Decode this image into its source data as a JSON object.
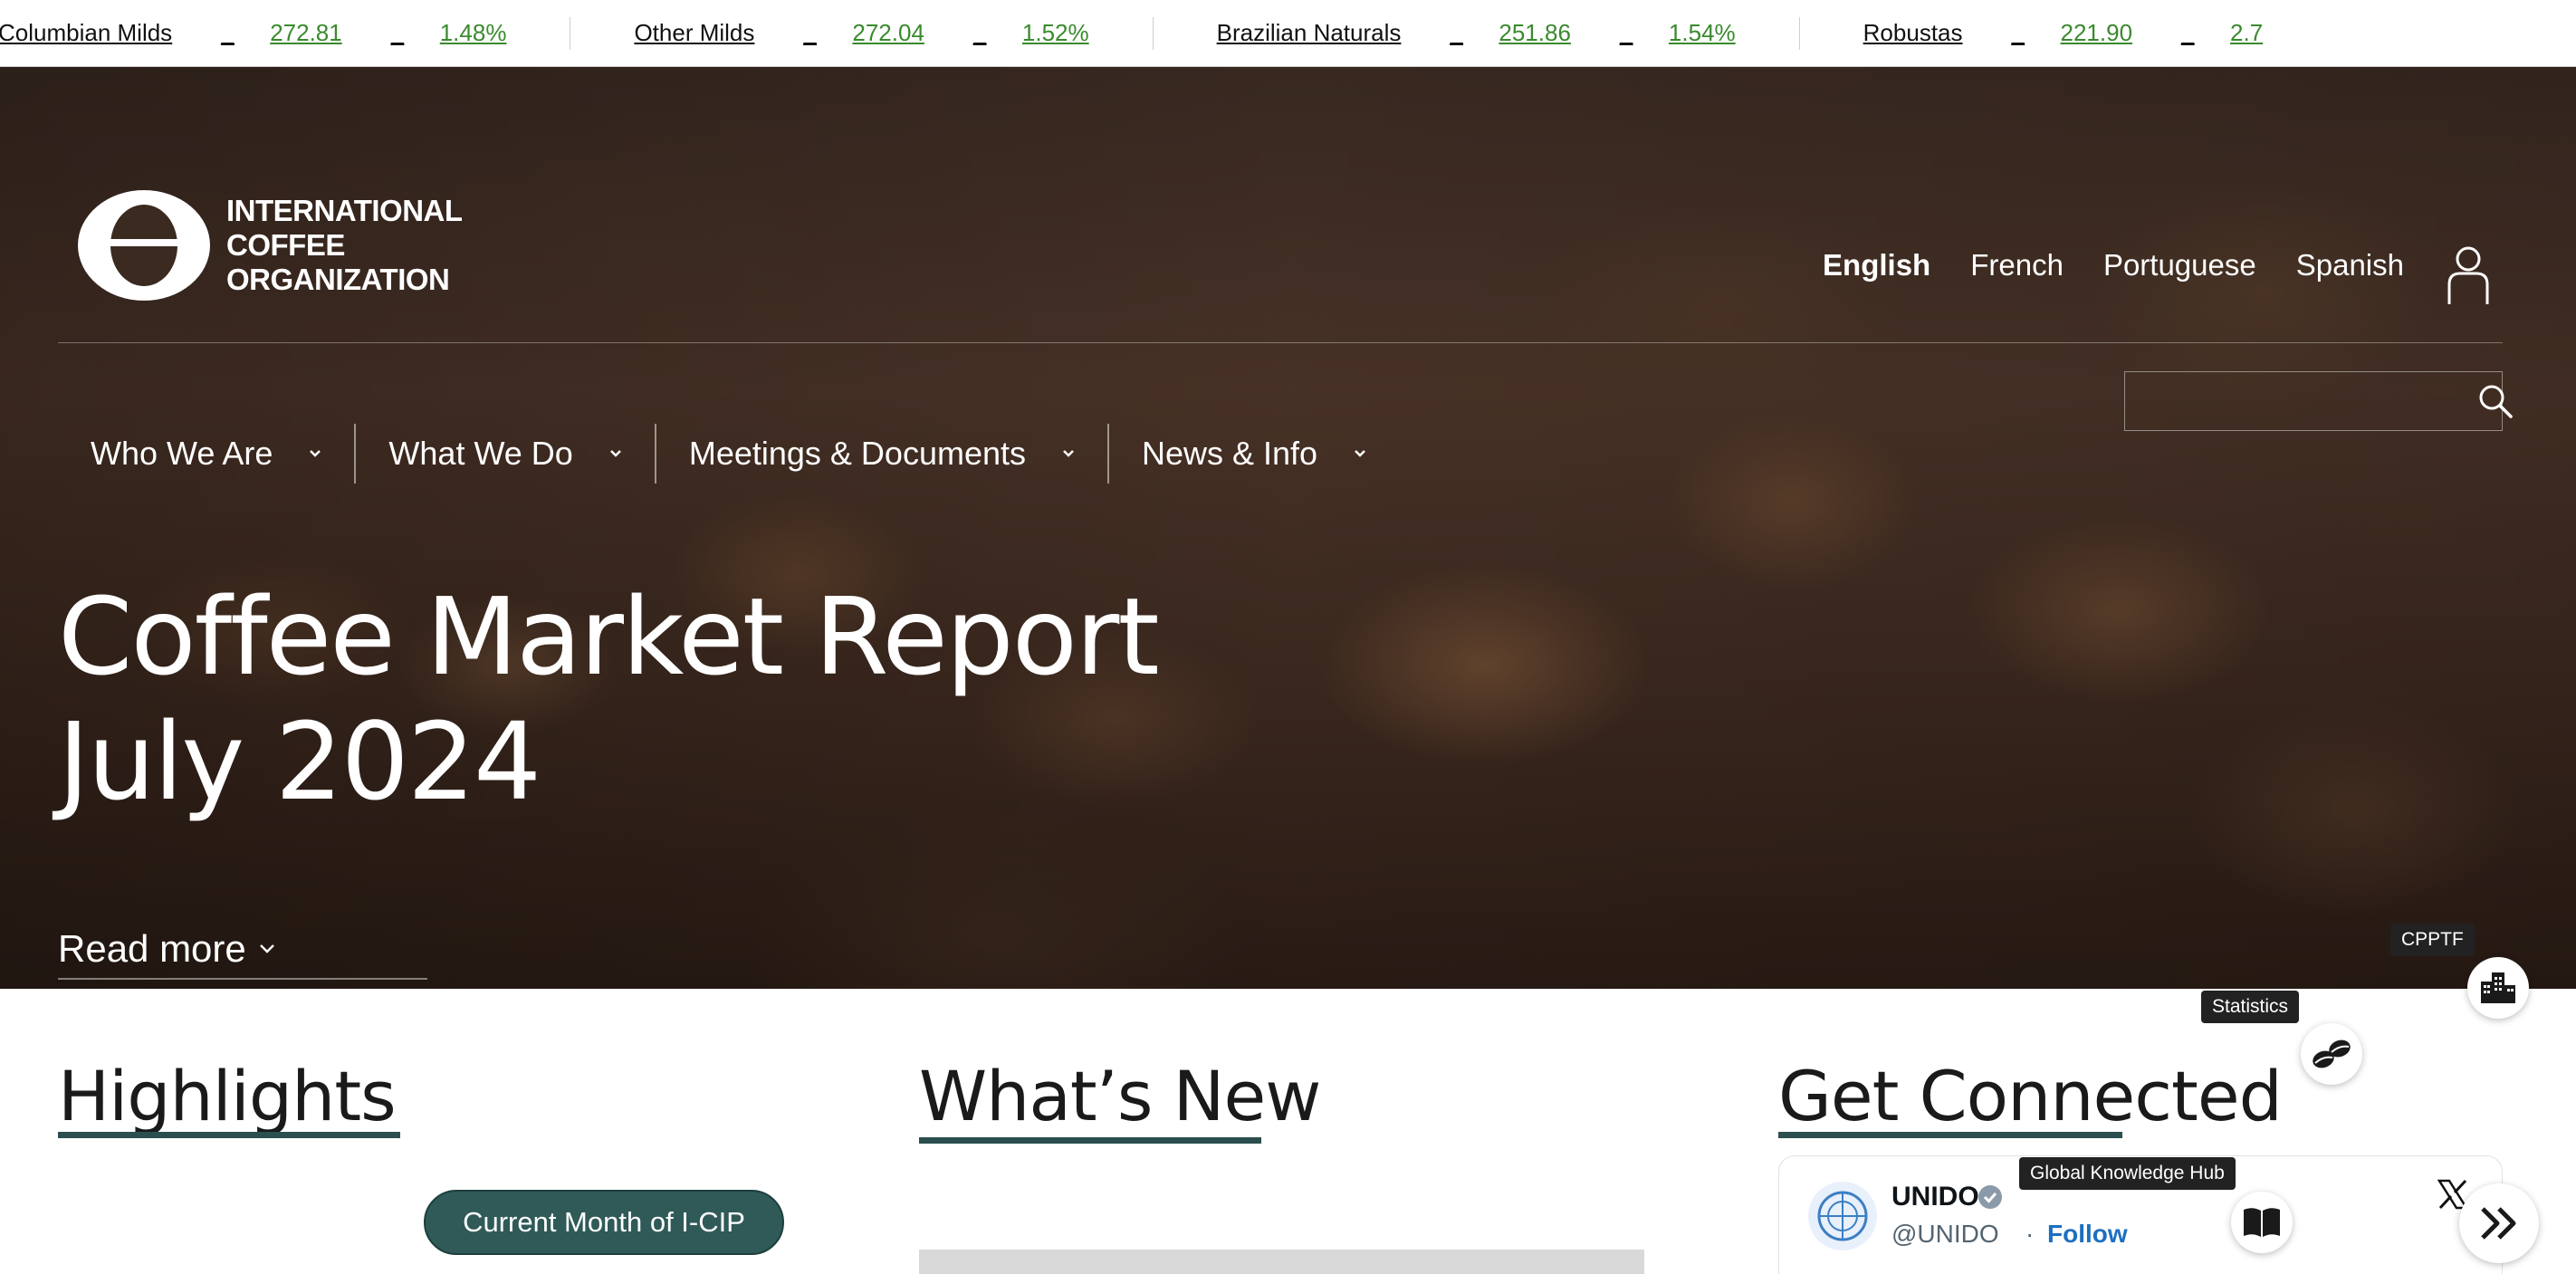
{
  "ticker": [
    {
      "name": "Columbian Milds",
      "separator": "_",
      "value": "272.81",
      "separator2": "_",
      "change": "1.48%"
    },
    {
      "name": "Other Milds",
      "separator": "_",
      "value": "272.04",
      "separator2": "_",
      "change": "1.52%"
    },
    {
      "name": "Brazilian Naturals",
      "separator": "_",
      "value": "251.86",
      "separator2": "_",
      "change": "1.54%"
    },
    {
      "name": "Robustas",
      "separator": "_",
      "value": "221.90",
      "separator2": "_",
      "change": "2.7"
    }
  ],
  "logo": {
    "line1": "INTERNATIONAL",
    "line2": "COFFEE",
    "line3": "ORGANIZATION"
  },
  "languages": {
    "english": "English",
    "french": "French",
    "portuguese": "Portuguese",
    "spanish": "Spanish"
  },
  "nav": {
    "who_we_are": "Who We Are",
    "what_we_do": "What We Do",
    "meetings_documents": "Meetings & Documents",
    "news_info": "News & Info"
  },
  "search": {
    "placeholder": ""
  },
  "hero": {
    "title_line1": "Coffee Market Report",
    "title_line2": "July 2024",
    "read_more": "Read more"
  },
  "sections": {
    "highlights": "Highlights",
    "whats_new": "What’s New",
    "get_connected": "Get Connected"
  },
  "highlights": {
    "cip_button": "Current Month of I-CIP"
  },
  "tweet": {
    "name": "UNIDO",
    "handle": "@UNIDO",
    "dot": "·",
    "follow": "Follow"
  },
  "widgets": {
    "cpptf": "CPPTF",
    "statistics": "Statistics",
    "knowledge_hub": "Global Knowledge Hub"
  },
  "colors": {
    "accent": "#2b4f4f",
    "button": "#2f5a58",
    "ticker_positive": "#3a8a2e",
    "follow_link": "#1d6fbf"
  }
}
